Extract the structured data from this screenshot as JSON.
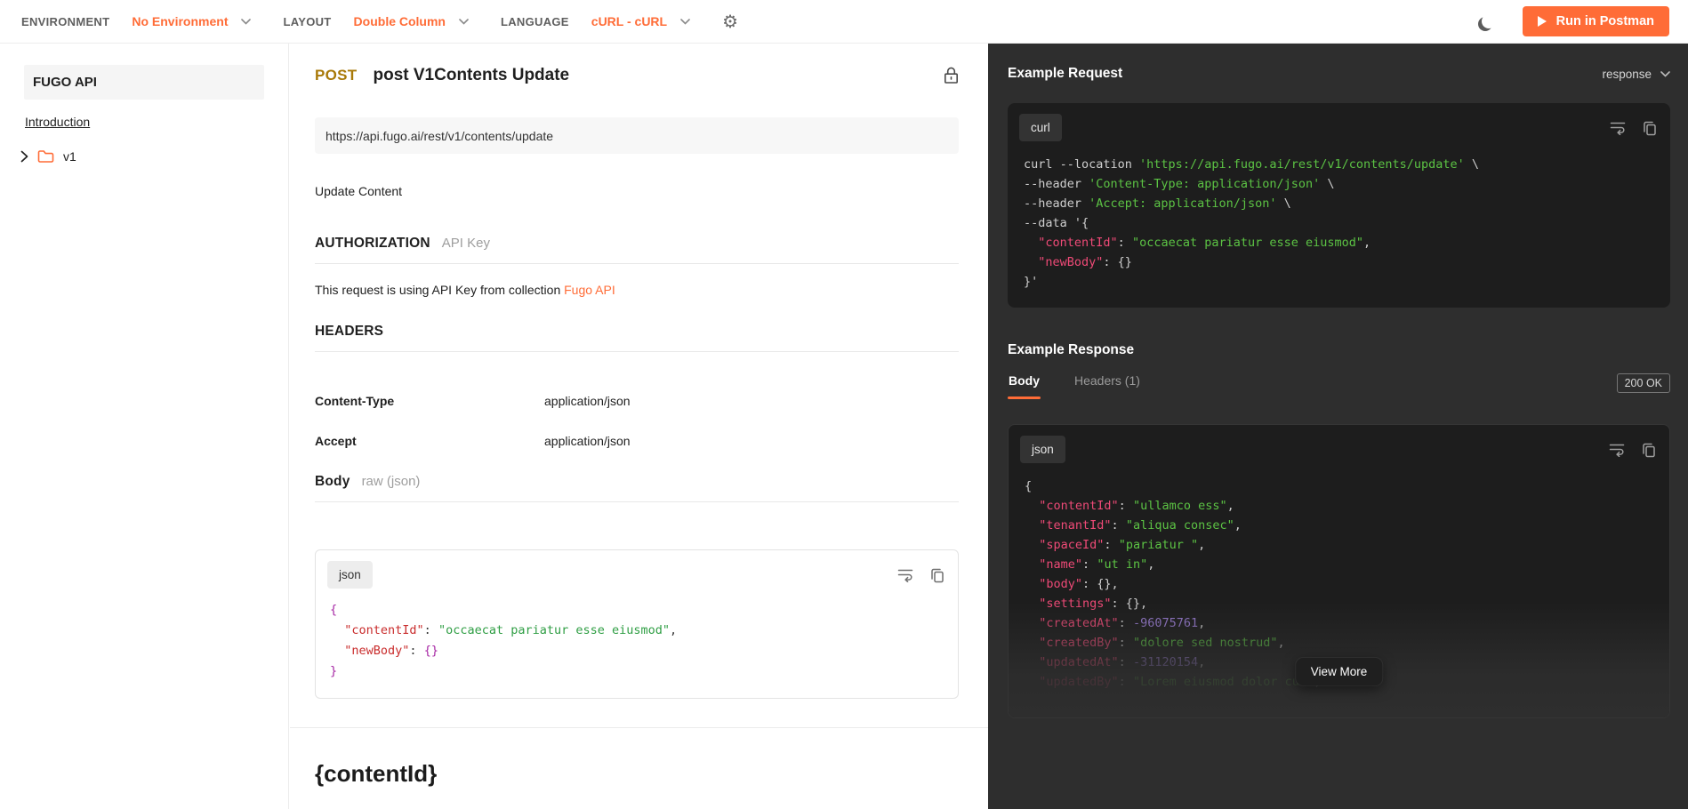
{
  "colors": {
    "accent_orange": "#ff6c37",
    "method_post": "#a87908",
    "panel_background": "#2e2e2e",
    "code_block_dark": "#1d1d1d",
    "code_key_dark": "#ef4a77",
    "code_string_dark": "#5cc344",
    "code_number_dark": "#9d7fd8",
    "code_key_light": "#c92c2c",
    "code_string_light": "#2f9e44"
  },
  "icons": {
    "settings": "gear-icon",
    "theme": "moon-icon",
    "run": "play-icon",
    "auth": "lock-icon",
    "folder": "folder-icon",
    "expand": "chevron-right-icon",
    "dropdown": "chevron-down-icon",
    "wrap": "wrap-text-icon",
    "copy": "copy-icon",
    "gear_glyph": "⚙"
  },
  "topbar": {
    "environment_label": "ENVIRONMENT",
    "environment_value": "No Environment",
    "layout_label": "LAYOUT",
    "layout_value": "Double Column",
    "language_label": "LANGUAGE",
    "language_value": "cURL - cURL",
    "run_button": "Run in Postman"
  },
  "sidebar": {
    "collection_name": "FUGO API",
    "items": [
      {
        "label": "Introduction"
      },
      {
        "label": "v1"
      }
    ]
  },
  "request": {
    "method": "POST",
    "title": "post V1Contents Update",
    "url": "https://api.fugo.ai/rest/v1/contents/update",
    "description": "Update Content",
    "authorization": {
      "heading": "AUTHORIZATION",
      "type": "API Key",
      "note_prefix": "This request is using API Key from collection ",
      "note_link": "Fugo API"
    },
    "headers": {
      "heading": "HEADERS",
      "rows": [
        {
          "key": "Content-Type",
          "value": "application/json"
        },
        {
          "key": "Accept",
          "value": "application/json"
        }
      ]
    },
    "body": {
      "heading": "Body",
      "mode": "raw (json)",
      "language": "json"
    },
    "footer_heading": "{contentId}"
  },
  "example_request": {
    "heading": "Example Request",
    "selector": "response",
    "language": "curl"
  },
  "example_response": {
    "heading": "Example Response",
    "tabs": [
      "Body",
      "Headers (1)"
    ],
    "active_tab": "Body",
    "status_badge": "200 OK",
    "language": "json",
    "view_more": "View More"
  },
  "code": {
    "request_body": [
      [
        [
          "b",
          "{"
        ]
      ],
      [
        [
          "p",
          "  "
        ],
        [
          "k",
          "\"contentId\""
        ],
        [
          "p",
          ": "
        ],
        [
          "s",
          "\"occaecat pariatur esse eiusmod\""
        ],
        [
          "p",
          ","
        ]
      ],
      [
        [
          "p",
          "  "
        ],
        [
          "k",
          "\"newBody\""
        ],
        [
          "p",
          ": "
        ],
        [
          "b",
          "{}"
        ]
      ],
      [
        [
          "b",
          "}"
        ]
      ]
    ],
    "curl": [
      [
        [
          "c",
          "curl --location "
        ],
        [
          "s",
          "'https://api.fugo.ai/rest/v1/contents/update'"
        ],
        [
          "c",
          " \\"
        ]
      ],
      [
        [
          "c",
          "--header "
        ],
        [
          "s",
          "'Content-Type: application/json'"
        ],
        [
          "c",
          " \\"
        ]
      ],
      [
        [
          "c",
          "--header "
        ],
        [
          "s",
          "'Accept: application/json'"
        ],
        [
          "c",
          " \\"
        ]
      ],
      [
        [
          "c",
          "--data '{"
        ]
      ],
      [
        [
          "c",
          "  "
        ],
        [
          "k",
          "\"contentId\""
        ],
        [
          "c",
          ": "
        ],
        [
          "s",
          "\"occaecat pariatur esse eiusmod\""
        ],
        [
          "c",
          ","
        ]
      ],
      [
        [
          "c",
          "  "
        ],
        [
          "k",
          "\"newBody\""
        ],
        [
          "c",
          ": {}"
        ]
      ],
      [
        [
          "c",
          "}'"
        ]
      ]
    ],
    "response": [
      [
        [
          "c",
          "{"
        ]
      ],
      [
        [
          "c",
          "  "
        ],
        [
          "k",
          "\"contentId\""
        ],
        [
          "c",
          ": "
        ],
        [
          "s",
          "\"ullamco ess\""
        ],
        [
          "c",
          ","
        ]
      ],
      [
        [
          "c",
          "  "
        ],
        [
          "k",
          "\"tenantId\""
        ],
        [
          "c",
          ": "
        ],
        [
          "s",
          "\"aliqua consec\""
        ],
        [
          "c",
          ","
        ]
      ],
      [
        [
          "c",
          "  "
        ],
        [
          "k",
          "\"spaceId\""
        ],
        [
          "c",
          ": "
        ],
        [
          "s",
          "\"pariatur \""
        ],
        [
          "c",
          ","
        ]
      ],
      [
        [
          "c",
          "  "
        ],
        [
          "k",
          "\"name\""
        ],
        [
          "c",
          ": "
        ],
        [
          "s",
          "\"ut in\""
        ],
        [
          "c",
          ","
        ]
      ],
      [
        [
          "c",
          "  "
        ],
        [
          "k",
          "\"body\""
        ],
        [
          "c",
          ": {},"
        ]
      ],
      [
        [
          "c",
          "  "
        ],
        [
          "k",
          "\"settings\""
        ],
        [
          "c",
          ": {},"
        ]
      ],
      [
        [
          "c",
          "  "
        ],
        [
          "k",
          "\"createdAt\""
        ],
        [
          "c",
          ": "
        ],
        [
          "n",
          "-96075761"
        ],
        [
          "c",
          ","
        ]
      ],
      [
        [
          "c",
          "  "
        ],
        [
          "k",
          "\"createdBy\""
        ],
        [
          "c",
          ": "
        ],
        [
          "s",
          "\"dolore sed nostrud\""
        ],
        [
          "c",
          ","
        ]
      ],
      [
        [
          "c",
          "  "
        ],
        [
          "k",
          "\"updatedAt\""
        ],
        [
          "c",
          ": "
        ],
        [
          "n",
          "-31120154"
        ],
        [
          "c",
          ","
        ]
      ],
      [
        [
          "c",
          "  "
        ],
        [
          "k",
          "\"updatedBy\""
        ],
        [
          "c",
          ": "
        ],
        [
          "s",
          "\"Lorem eiusmod dolor cul\""
        ],
        [
          "c",
          ","
        ]
      ]
    ]
  }
}
